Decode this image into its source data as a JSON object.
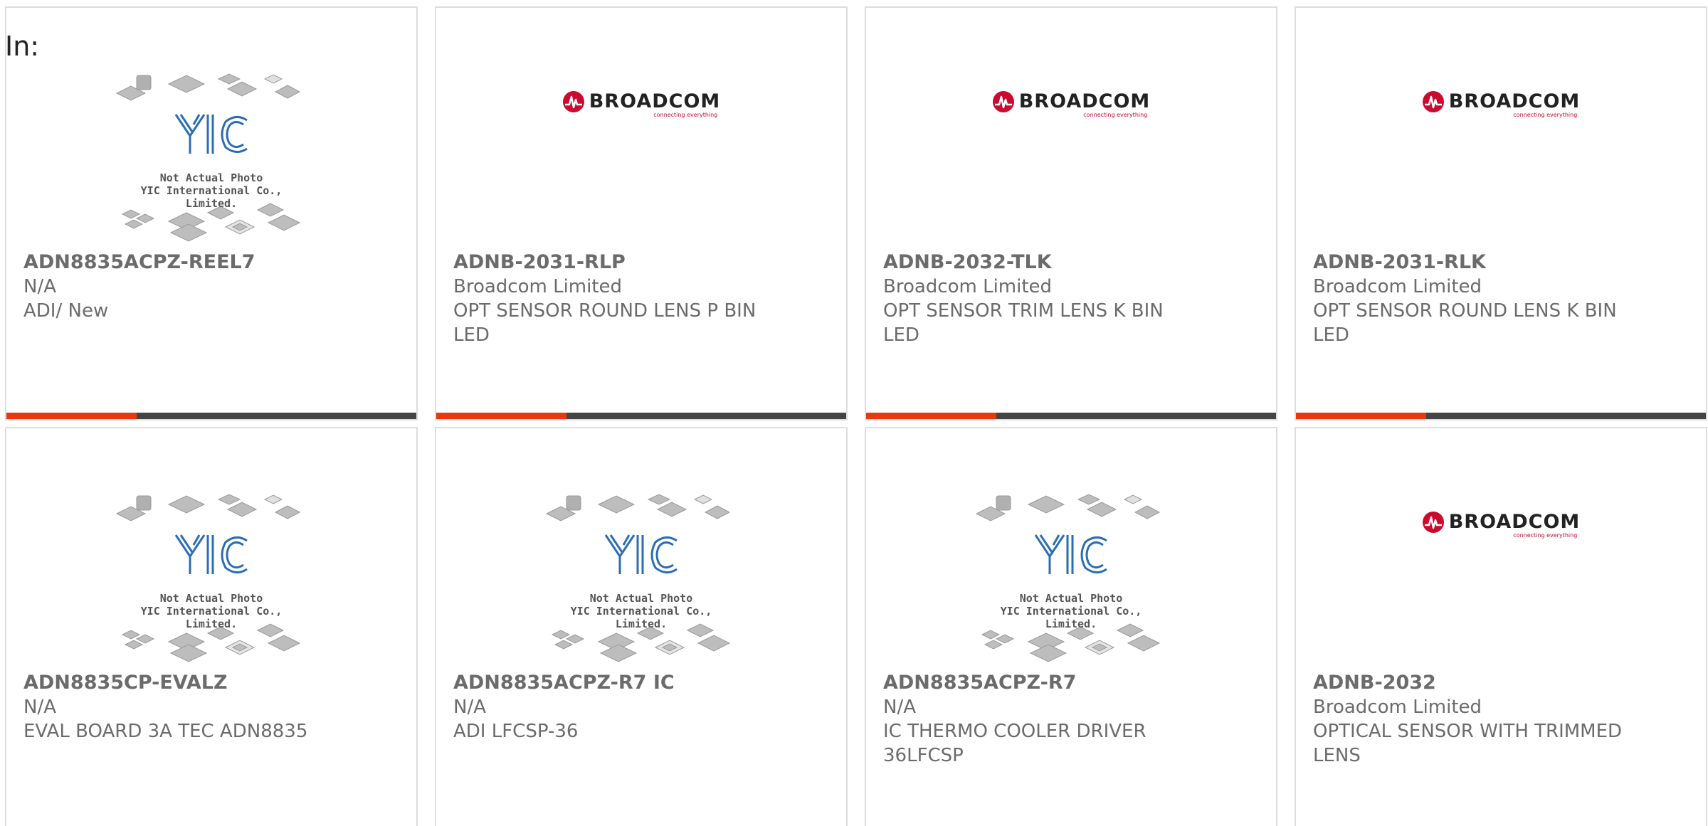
{
  "header": {
    "in_label": "In:"
  },
  "placeholder": {
    "line1": "Not Actual Photo",
    "line2": "YIC International Co., Limited.",
    "logo": "YIC"
  },
  "broadcom": {
    "word": "BROADCOM",
    "tagline": "connecting everything"
  },
  "colors": {
    "accent": "#e8380d",
    "bar": "#444444",
    "text": "#6b6b6b",
    "brand_red": "#cc092f",
    "yic_blue": "#2a6db5"
  },
  "products": [
    {
      "part": "ADN8835ACPZ-REEL7",
      "maker": "N/A",
      "desc": "ADI/ New",
      "image": "yic-placeholder"
    },
    {
      "part": "ADNB-2031-RLP",
      "maker": "Broadcom Limited",
      "desc": "OPT SENSOR ROUND LENS P BIN LED",
      "image": "broadcom-logo"
    },
    {
      "part": "ADNB-2032-TLK",
      "maker": "Broadcom Limited",
      "desc": "OPT SENSOR TRIM LENS K BIN LED",
      "image": "broadcom-logo"
    },
    {
      "part": "ADNB-2031-RLK",
      "maker": "Broadcom Limited",
      "desc": "OPT SENSOR ROUND LENS K BIN LED",
      "image": "broadcom-logo"
    },
    {
      "part": "ADN8835CP-EVALZ",
      "maker": "N/A",
      "desc": "EVAL BOARD 3A TEC ADN8835",
      "image": "yic-placeholder"
    },
    {
      "part": "ADN8835ACPZ-R7 IC",
      "maker": "N/A",
      "desc": "ADI LFCSP-36",
      "image": "yic-placeholder"
    },
    {
      "part": "ADN8835ACPZ-R7",
      "maker": "N/A",
      "desc": "IC THERMO COOLER DRIVER 36LFCSP",
      "image": "yic-placeholder"
    },
    {
      "part": "ADNB-2032",
      "maker": "Broadcom Limited",
      "desc": "OPTICAL SENSOR WITH TRIMMED LENS",
      "image": "broadcom-logo"
    }
  ]
}
